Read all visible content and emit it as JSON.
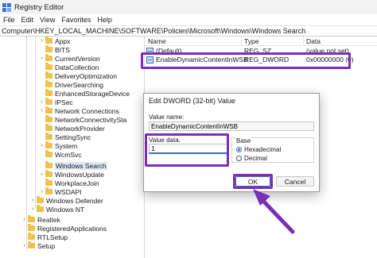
{
  "window": {
    "title": "Registry Editor"
  },
  "menu": [
    "File",
    "Edit",
    "View",
    "Favorites",
    "Help"
  ],
  "address": "Computer\\HKEY_LOCAL_MACHINE\\SOFTWARE\\Policies\\Microsoft\\Windows\\Windows Search",
  "tree": [
    {
      "label": "Appx"
    },
    {
      "label": "BITS"
    },
    {
      "label": "CurrentVersion"
    },
    {
      "label": "DataCollection"
    },
    {
      "label": "DeliveryOptimization"
    },
    {
      "label": "DriverSearching"
    },
    {
      "label": "EnhancedStorageDevice"
    },
    {
      "label": "IPSec"
    },
    {
      "label": "Network Connections"
    },
    {
      "label": "NetworkConnectivitySta"
    },
    {
      "label": "NetworkProvider"
    },
    {
      "label": "SettingSync"
    },
    {
      "label": "System"
    },
    {
      "label": "WcmSvc"
    },
    {
      "label": "Windows Search"
    },
    {
      "label": "WindowsUpdate"
    },
    {
      "label": "WorkplaceJoin"
    },
    {
      "label": "WSDAPI"
    },
    {
      "label": "Windows Defender"
    },
    {
      "label": "Windows NT"
    },
    {
      "label": "Realtek"
    },
    {
      "label": "RegisteredApplications"
    },
    {
      "label": "RTLSetup"
    },
    {
      "label": "Setup"
    }
  ],
  "list": {
    "columns": [
      "Name",
      "Type",
      "Data"
    ],
    "rows": [
      {
        "name": "(Default)",
        "type": "REG_SZ",
        "data": "(value not set)"
      },
      {
        "name": "EnableDynamicContentInWSB",
        "type": "REG_DWORD",
        "data": "0x00000000 (0)"
      }
    ]
  },
  "dialog": {
    "title": "Edit DWORD (32-bit) Value",
    "value_name_label": "Value name:",
    "value_name": "EnableDynamicContentInWSB",
    "value_data_label": "Value data:",
    "value_data": "1",
    "base_label": "Base",
    "base_options": [
      "Hexadecimal",
      "Decimal"
    ],
    "base_selected": "Hexadecimal",
    "ok_label": "OK",
    "cancel_label": "Cancel"
  },
  "colors": {
    "annotation": "#7b2fb5",
    "selection": "#dde8f5",
    "accent": "#3a6fb0"
  }
}
